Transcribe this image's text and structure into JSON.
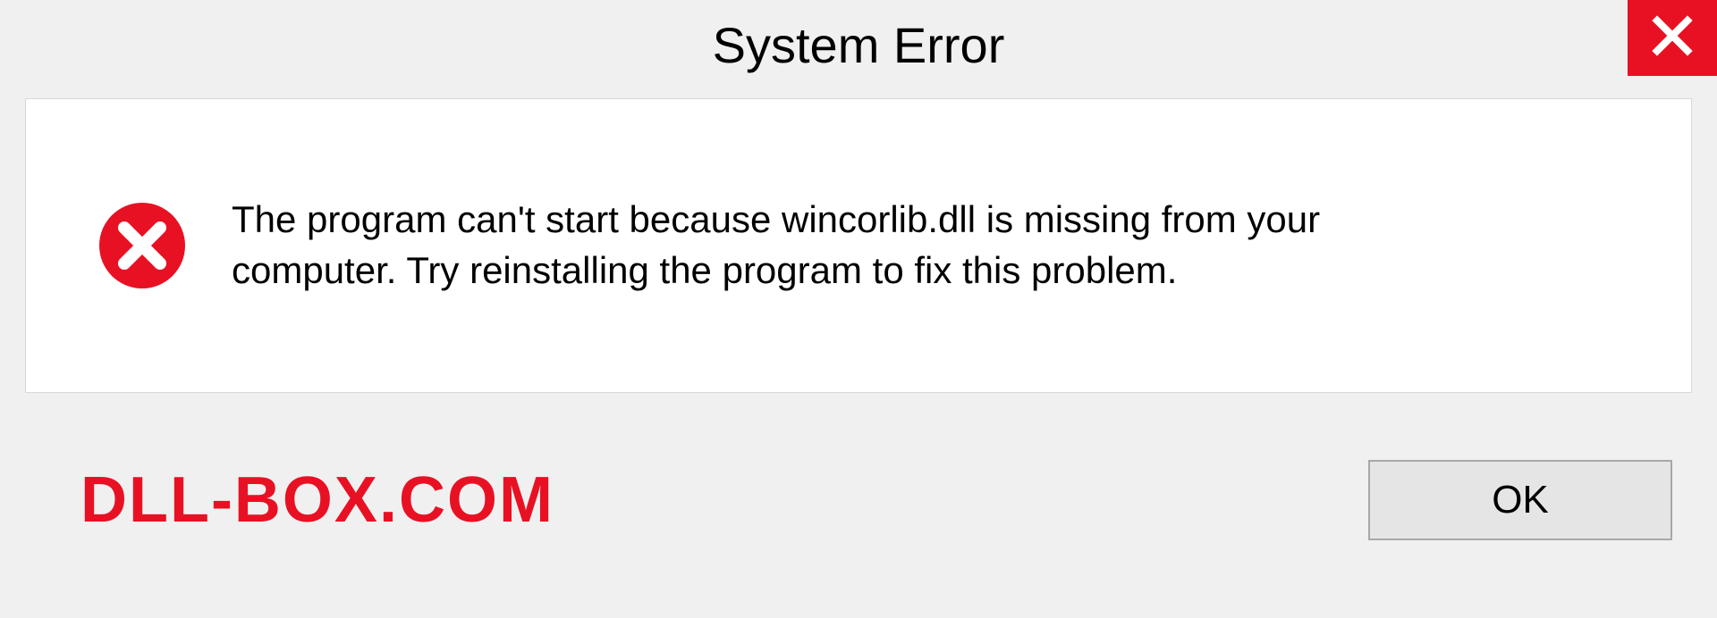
{
  "dialog": {
    "title": "System Error",
    "message": "The program can't start because wincorlib.dll is missing from your computer. Try reinstalling the program to fix this problem.",
    "ok_label": "OK"
  },
  "watermark": "DLL-BOX.COM",
  "colors": {
    "accent_red": "#e81123"
  }
}
